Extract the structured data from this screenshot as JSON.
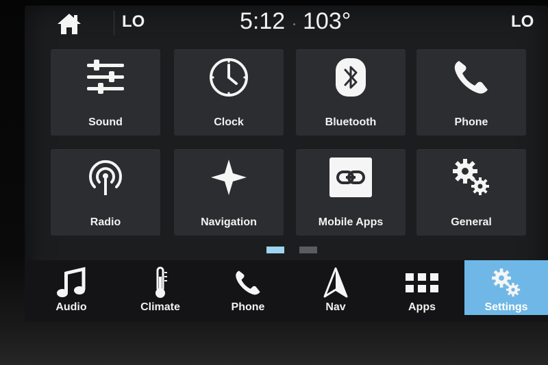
{
  "status": {
    "temp_left": "LO",
    "time": "5:12",
    "outside_temp": "103°",
    "temp_right": "LO"
  },
  "grid": [
    {
      "label": "Sound",
      "icon": "equalizer-icon"
    },
    {
      "label": "Clock",
      "icon": "clock-icon"
    },
    {
      "label": "Bluetooth",
      "icon": "bluetooth-icon"
    },
    {
      "label": "Phone",
      "icon": "phone-icon"
    },
    {
      "label": "Radio",
      "icon": "radio-antenna-icon"
    },
    {
      "label": "Navigation",
      "icon": "compass-star-icon"
    },
    {
      "label": "Mobile Apps",
      "icon": "link-icon"
    },
    {
      "label": "General",
      "icon": "gears-icon"
    }
  ],
  "pager": {
    "current_page": 1,
    "total_pages": 2,
    "active_color": "#9fd4f2",
    "inactive_color": "#5a5c60"
  },
  "navbar": [
    {
      "label": "Audio",
      "icon": "music-note-icon"
    },
    {
      "label": "Climate",
      "icon": "thermometer-icon"
    },
    {
      "label": "Phone",
      "icon": "phone-icon"
    },
    {
      "label": "Nav",
      "icon": "navigation-arrow-icon"
    },
    {
      "label": "Apps",
      "icon": "apps-grid-icon"
    },
    {
      "label": "Settings",
      "icon": "gears-icon",
      "active": true
    }
  ],
  "colors": {
    "accent": "#6fb7e6",
    "tile": "#2c2d30",
    "background": "#1c1d1f"
  }
}
